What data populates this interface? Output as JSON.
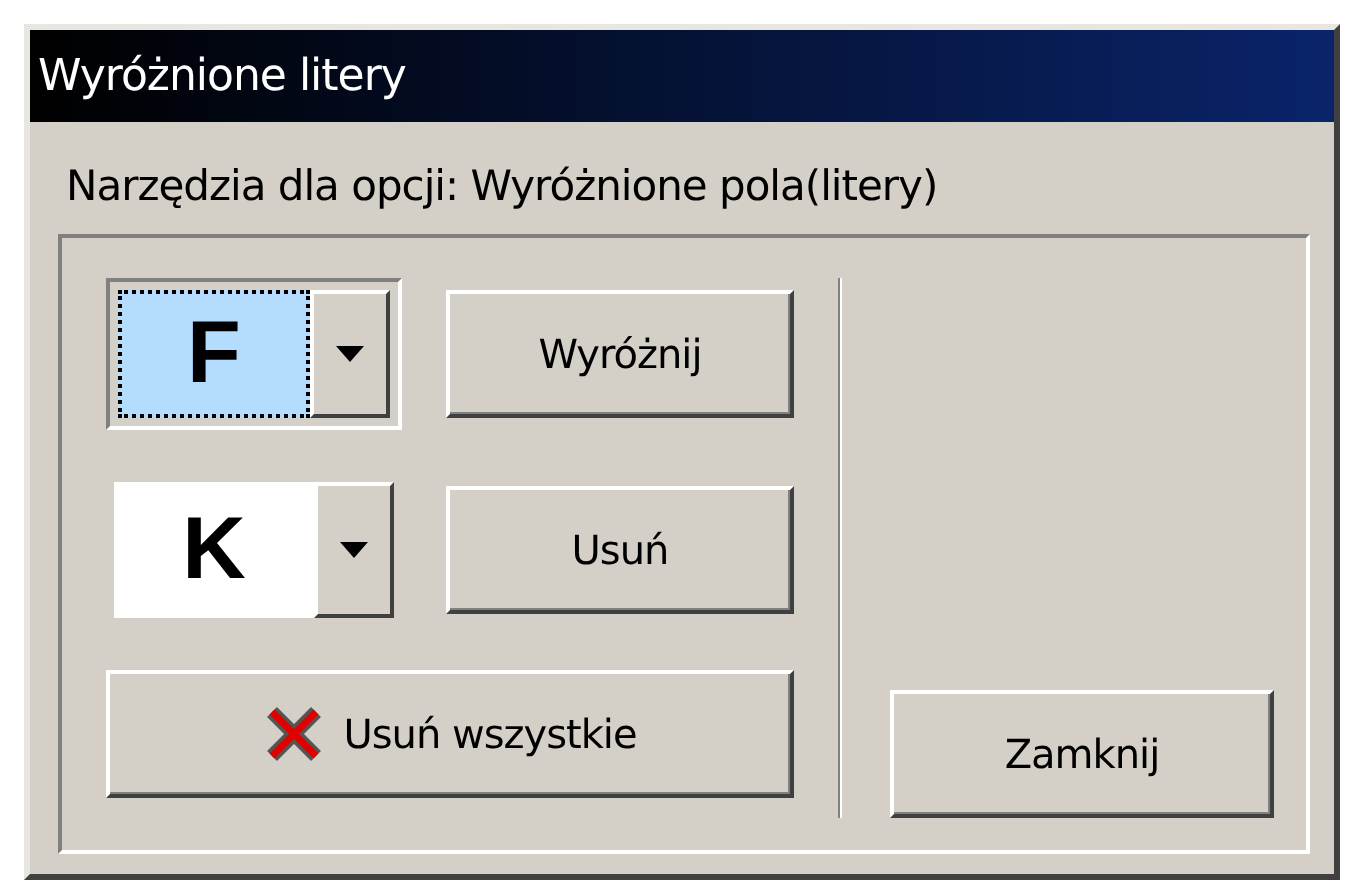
{
  "window": {
    "title": "Wyróżnione litery"
  },
  "heading": "Narzędzia dla opcji: Wyróżnione pola(litery)",
  "rows": [
    {
      "letter": "F",
      "selected": true,
      "button": "Wyróżnij"
    },
    {
      "letter": "K",
      "selected": false,
      "button": "Usuń"
    }
  ],
  "clear_all_button": "Usuń wszystkie",
  "close_button": "Zamknij"
}
